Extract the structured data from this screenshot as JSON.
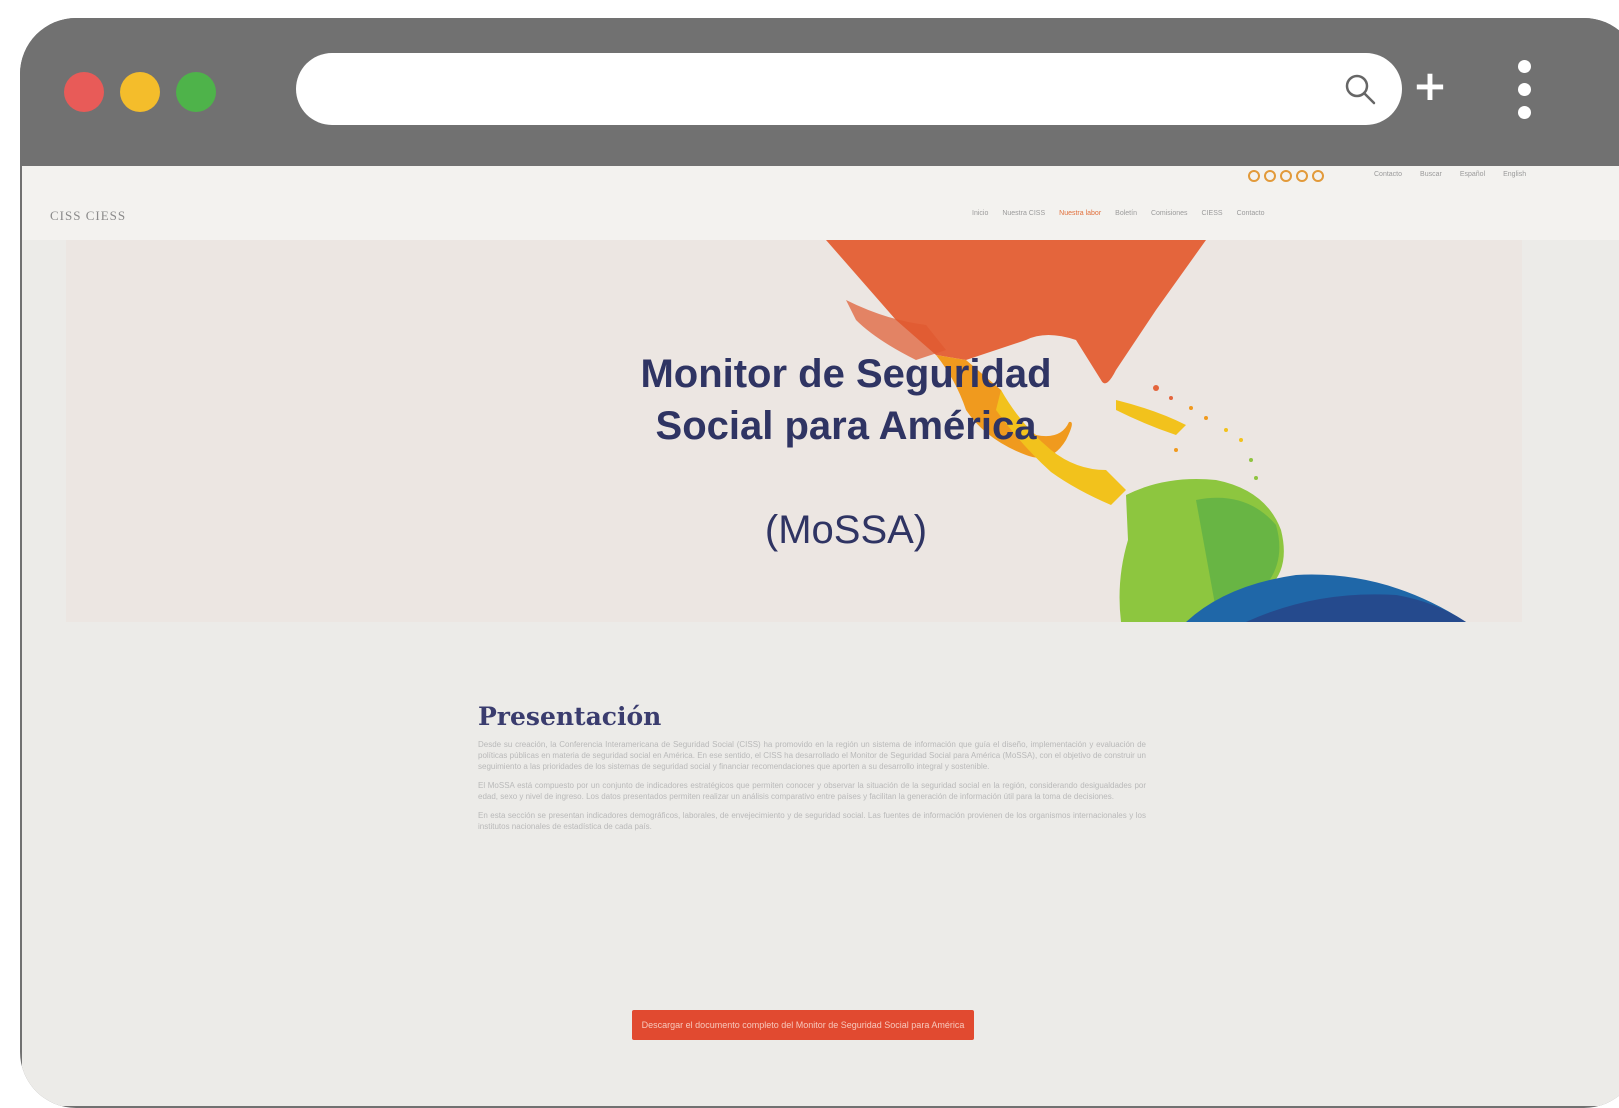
{
  "browser": {
    "controls": [
      "close",
      "minimize",
      "maximize"
    ],
    "address_value": "",
    "icons": {
      "search": "search-icon",
      "new_tab": "plus-icon",
      "menu": "kebab-menu-icon"
    }
  },
  "site": {
    "logo_text": "CISS  CIESS",
    "nav": [
      {
        "label": "Inicio"
      },
      {
        "label": "Nuestra CISS"
      },
      {
        "label": "Nuestra labor"
      },
      {
        "label": "Boletín"
      },
      {
        "label": "Comisiones"
      },
      {
        "label": "CIESS"
      },
      {
        "label": "Contacto"
      }
    ],
    "top_links": [
      "Contacto",
      "Buscar",
      "Español",
      "English"
    ],
    "social_count": 5
  },
  "hero": {
    "title": "Monitor de Seguridad Social para América",
    "subtitle": "(MoSSA)"
  },
  "content": {
    "heading": "Presentación",
    "paragraphs": [
      "Desde su creación, la Conferencia Interamericana de Seguridad Social (CISS) ha promovido en la región un sistema de información que guía el diseño, implementación y evaluación de políticas públicas en materia de seguridad social en América. En ese sentido, el CISS ha desarrollado el Monitor de Seguridad Social para América (MoSSA), con el objetivo de construir un seguimiento a las prioridades de los sistemas de seguridad social y financiar recomendaciones que aporten a su desarrollo integral y sostenible.",
      "El MoSSA está compuesto por un conjunto de indicadores estratégicos que permiten conocer y observar la situación de la seguridad social en la región, considerando desigualdades por edad, sexo y nivel de ingreso. Los datos presentados permiten realizar un análisis comparativo entre países y facilitan la generación de información útil para la toma de decisiones.",
      "En esta sección se presentan indicadores demográficos, laborales, de envejecimiento y de seguridad social. Las fuentes de información provienen de los organismos internacionales y los institutos nacionales de estadística de cada país."
    ],
    "cta_label": "Descargar el documento completo del Monitor de Seguridad Social para América"
  }
}
